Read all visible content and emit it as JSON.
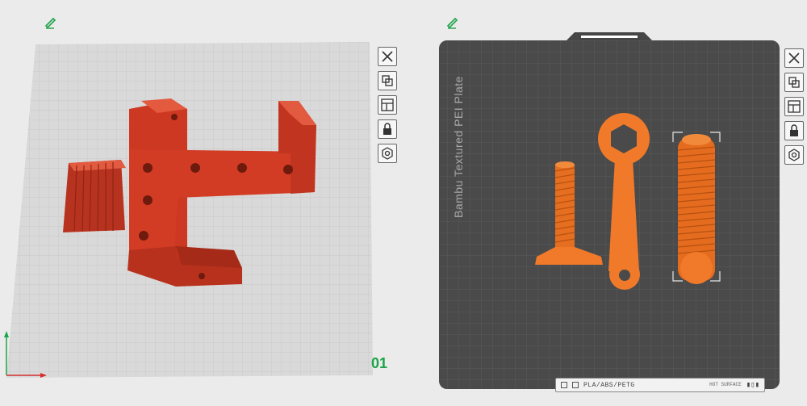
{
  "plates": [
    {
      "number": "01",
      "actions": [
        "close-icon",
        "arrange-icon",
        "layout-icon",
        "lock-icon",
        "settings-icon"
      ]
    },
    {
      "plate_type_label": "Bambu Textured PEI Plate",
      "filament_label": "PLA/ABS/PETG",
      "hot_surface_label": "HOT SURFACE",
      "actions": [
        "close-icon",
        "arrange-icon",
        "layout-icon",
        "lock-icon",
        "settings-icon"
      ]
    }
  ],
  "colors": {
    "background": "#ebebeb",
    "plate_light": "#d7d7d7",
    "plate_dark": "#4a4a4a",
    "model_red": "#d03a23",
    "model_orange": "#f07a2a",
    "accent_green": "#1ea34a"
  }
}
